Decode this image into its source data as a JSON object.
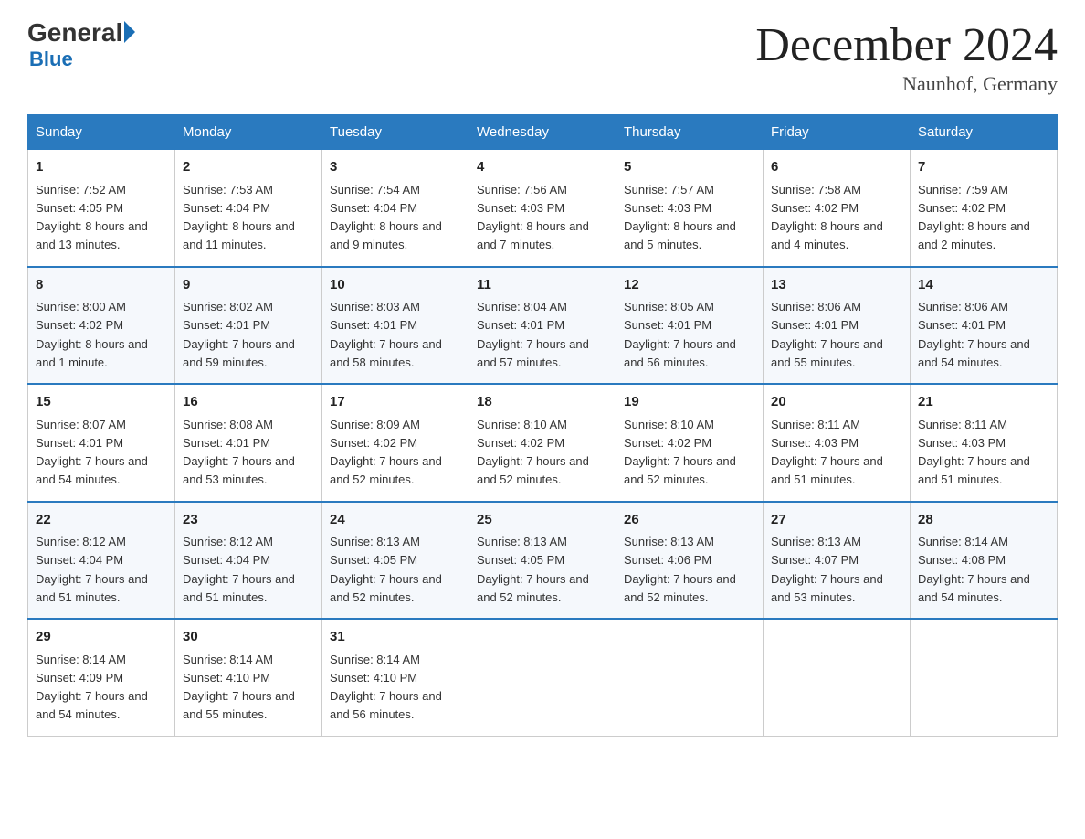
{
  "header": {
    "logo_general": "General",
    "logo_blue": "Blue",
    "month_title": "December 2024",
    "location": "Naunhof, Germany"
  },
  "weekdays": [
    "Sunday",
    "Monday",
    "Tuesday",
    "Wednesday",
    "Thursday",
    "Friday",
    "Saturday"
  ],
  "weeks": [
    [
      {
        "day": "1",
        "sunrise": "7:52 AM",
        "sunset": "4:05 PM",
        "daylight": "8 hours and 13 minutes."
      },
      {
        "day": "2",
        "sunrise": "7:53 AM",
        "sunset": "4:04 PM",
        "daylight": "8 hours and 11 minutes."
      },
      {
        "day": "3",
        "sunrise": "7:54 AM",
        "sunset": "4:04 PM",
        "daylight": "8 hours and 9 minutes."
      },
      {
        "day": "4",
        "sunrise": "7:56 AM",
        "sunset": "4:03 PM",
        "daylight": "8 hours and 7 minutes."
      },
      {
        "day": "5",
        "sunrise": "7:57 AM",
        "sunset": "4:03 PM",
        "daylight": "8 hours and 5 minutes."
      },
      {
        "day": "6",
        "sunrise": "7:58 AM",
        "sunset": "4:02 PM",
        "daylight": "8 hours and 4 minutes."
      },
      {
        "day": "7",
        "sunrise": "7:59 AM",
        "sunset": "4:02 PM",
        "daylight": "8 hours and 2 minutes."
      }
    ],
    [
      {
        "day": "8",
        "sunrise": "8:00 AM",
        "sunset": "4:02 PM",
        "daylight": "8 hours and 1 minute."
      },
      {
        "day": "9",
        "sunrise": "8:02 AM",
        "sunset": "4:01 PM",
        "daylight": "7 hours and 59 minutes."
      },
      {
        "day": "10",
        "sunrise": "8:03 AM",
        "sunset": "4:01 PM",
        "daylight": "7 hours and 58 minutes."
      },
      {
        "day": "11",
        "sunrise": "8:04 AM",
        "sunset": "4:01 PM",
        "daylight": "7 hours and 57 minutes."
      },
      {
        "day": "12",
        "sunrise": "8:05 AM",
        "sunset": "4:01 PM",
        "daylight": "7 hours and 56 minutes."
      },
      {
        "day": "13",
        "sunrise": "8:06 AM",
        "sunset": "4:01 PM",
        "daylight": "7 hours and 55 minutes."
      },
      {
        "day": "14",
        "sunrise": "8:06 AM",
        "sunset": "4:01 PM",
        "daylight": "7 hours and 54 minutes."
      }
    ],
    [
      {
        "day": "15",
        "sunrise": "8:07 AM",
        "sunset": "4:01 PM",
        "daylight": "7 hours and 54 minutes."
      },
      {
        "day": "16",
        "sunrise": "8:08 AM",
        "sunset": "4:01 PM",
        "daylight": "7 hours and 53 minutes."
      },
      {
        "day": "17",
        "sunrise": "8:09 AM",
        "sunset": "4:02 PM",
        "daylight": "7 hours and 52 minutes."
      },
      {
        "day": "18",
        "sunrise": "8:10 AM",
        "sunset": "4:02 PM",
        "daylight": "7 hours and 52 minutes."
      },
      {
        "day": "19",
        "sunrise": "8:10 AM",
        "sunset": "4:02 PM",
        "daylight": "7 hours and 52 minutes."
      },
      {
        "day": "20",
        "sunrise": "8:11 AM",
        "sunset": "4:03 PM",
        "daylight": "7 hours and 51 minutes."
      },
      {
        "day": "21",
        "sunrise": "8:11 AM",
        "sunset": "4:03 PM",
        "daylight": "7 hours and 51 minutes."
      }
    ],
    [
      {
        "day": "22",
        "sunrise": "8:12 AM",
        "sunset": "4:04 PM",
        "daylight": "7 hours and 51 minutes."
      },
      {
        "day": "23",
        "sunrise": "8:12 AM",
        "sunset": "4:04 PM",
        "daylight": "7 hours and 51 minutes."
      },
      {
        "day": "24",
        "sunrise": "8:13 AM",
        "sunset": "4:05 PM",
        "daylight": "7 hours and 52 minutes."
      },
      {
        "day": "25",
        "sunrise": "8:13 AM",
        "sunset": "4:05 PM",
        "daylight": "7 hours and 52 minutes."
      },
      {
        "day": "26",
        "sunrise": "8:13 AM",
        "sunset": "4:06 PM",
        "daylight": "7 hours and 52 minutes."
      },
      {
        "day": "27",
        "sunrise": "8:13 AM",
        "sunset": "4:07 PM",
        "daylight": "7 hours and 53 minutes."
      },
      {
        "day": "28",
        "sunrise": "8:14 AM",
        "sunset": "4:08 PM",
        "daylight": "7 hours and 54 minutes."
      }
    ],
    [
      {
        "day": "29",
        "sunrise": "8:14 AM",
        "sunset": "4:09 PM",
        "daylight": "7 hours and 54 minutes."
      },
      {
        "day": "30",
        "sunrise": "8:14 AM",
        "sunset": "4:10 PM",
        "daylight": "7 hours and 55 minutes."
      },
      {
        "day": "31",
        "sunrise": "8:14 AM",
        "sunset": "4:10 PM",
        "daylight": "7 hours and 56 minutes."
      },
      null,
      null,
      null,
      null
    ]
  ],
  "labels": {
    "sunrise": "Sunrise:",
    "sunset": "Sunset:",
    "daylight": "Daylight:"
  }
}
